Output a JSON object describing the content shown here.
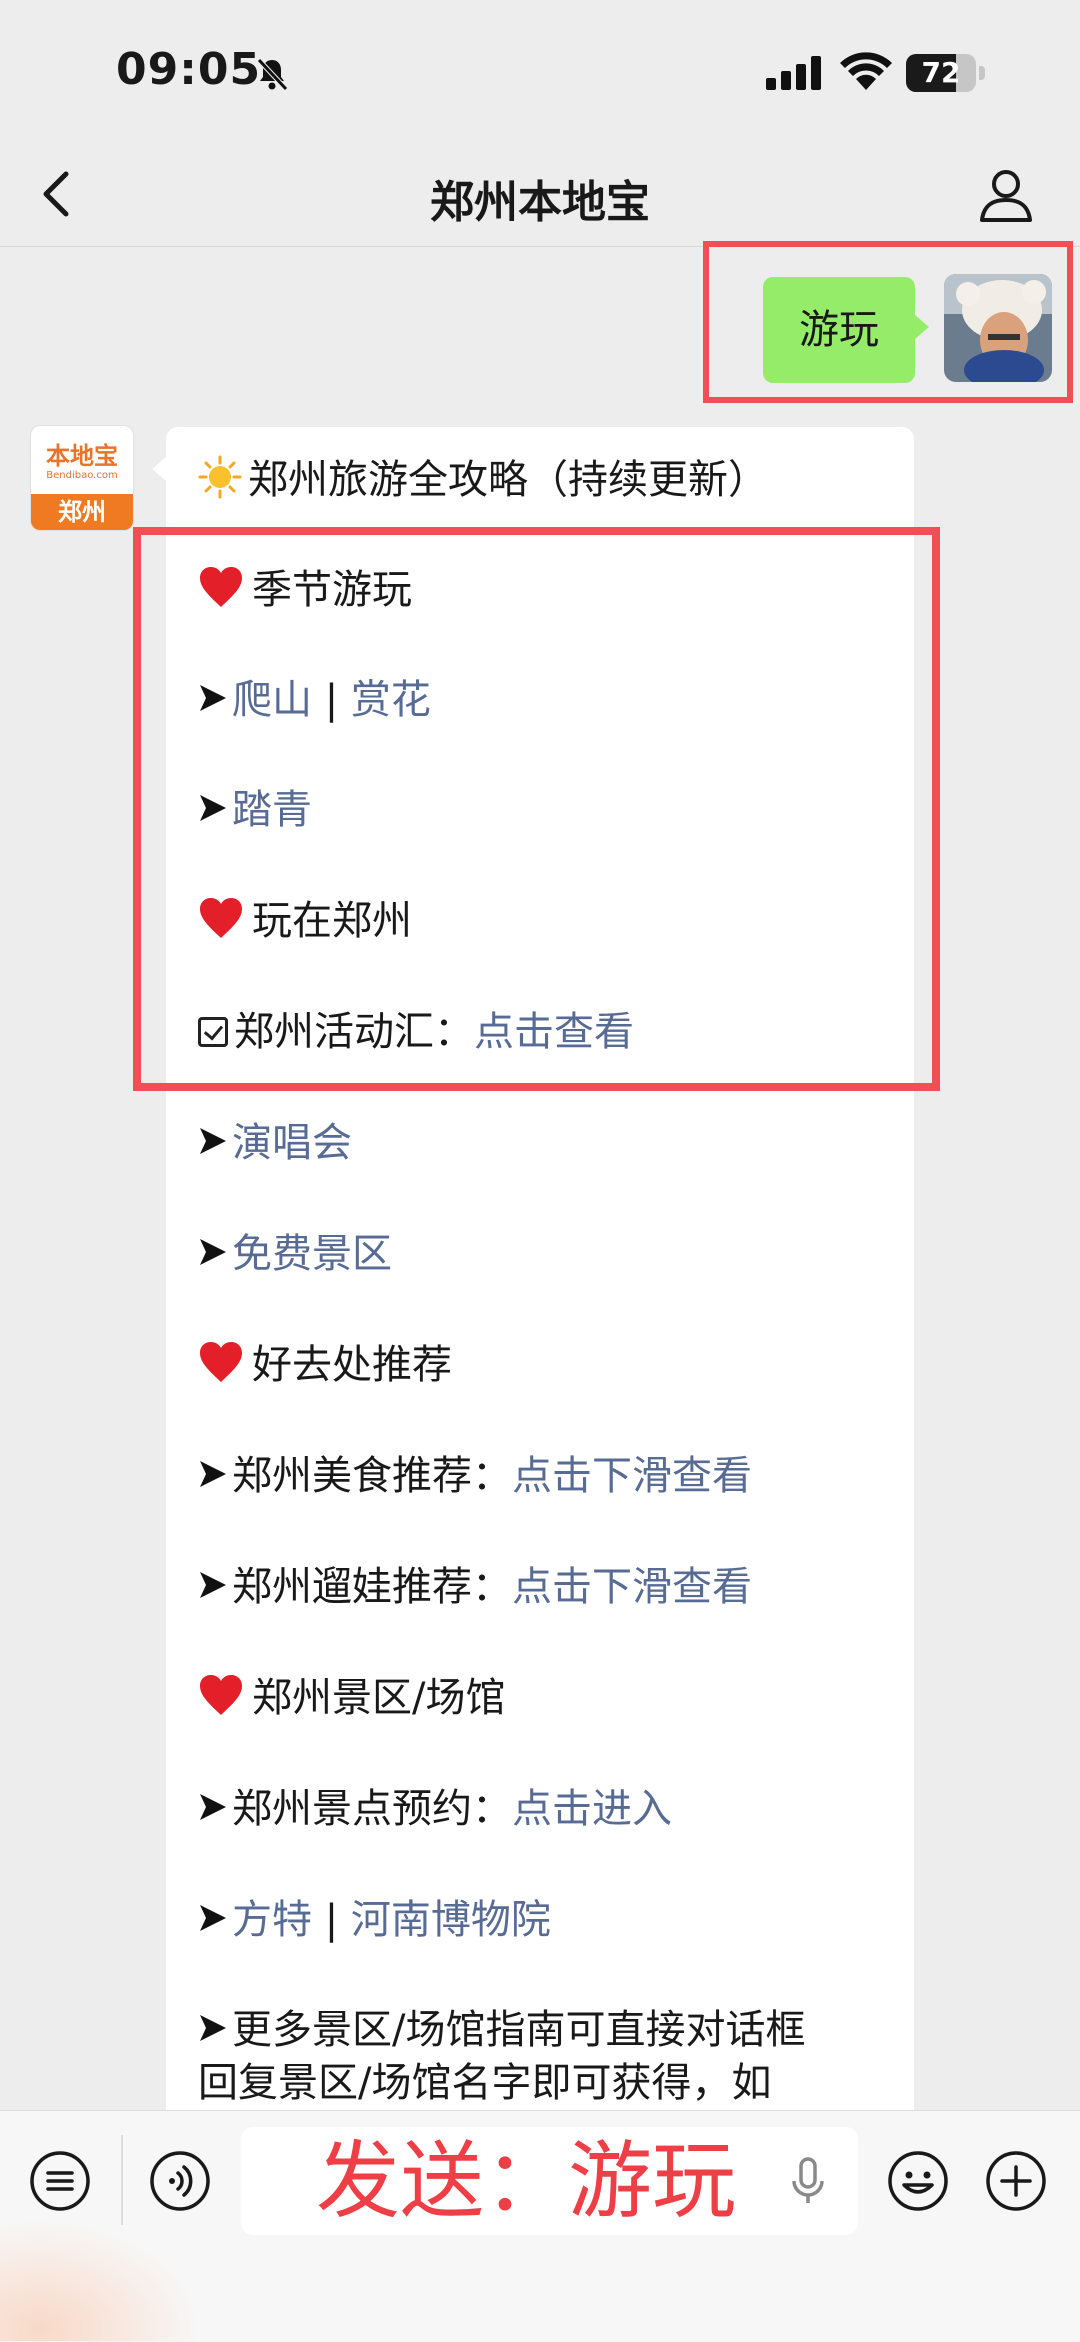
{
  "status_bar": {
    "time": "09:05",
    "battery": "72",
    "battery_level": 0.72
  },
  "nav": {
    "title": "郑州本地宝"
  },
  "outgoing": {
    "text": "游玩"
  },
  "incoming_avatar": {
    "logo_text": "本地宝",
    "logo_sub": "Bendibao.com",
    "city": "郑州"
  },
  "message": {
    "heading": "郑州旅游全攻略（持续更新）",
    "season": "季节游玩",
    "climb": "爬山",
    "sep1": " | ",
    "flowers": "赏花",
    "outing": "踏青",
    "play": "玩在郑州",
    "activity_label": "郑州活动汇：",
    "activity_link": "点击查看",
    "concert": "演唱会",
    "free": "免费景区",
    "recommend": "好去处推荐",
    "food_label": "郑州美食推荐：",
    "food_link": "点击下滑查看",
    "kids_label": "郑州遛娃推荐：",
    "kids_link": "点击下滑查看",
    "venues": "郑州景区/场馆",
    "booking_label": "郑州景点预约：",
    "booking_link": "点击进入",
    "fangte": "方特",
    "sep2": " | ",
    "museum": "河南博物院",
    "more_line1": "更多景区/场馆指南可直接对话框",
    "more_line2": "回复景区/场馆名字即可获得，如"
  },
  "input": {
    "text": "发送：游玩"
  }
}
